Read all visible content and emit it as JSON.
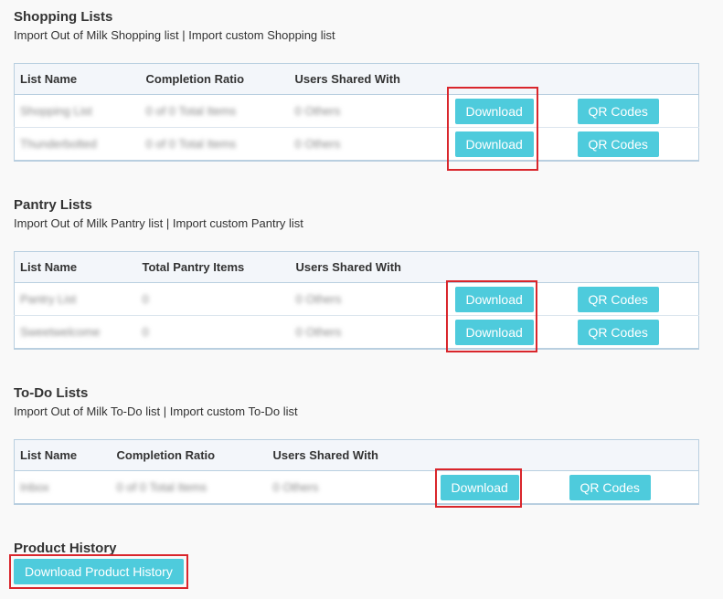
{
  "shopping": {
    "title": "Shopping Lists",
    "import_out_of_milk": "Import Out of Milk Shopping list",
    "separator": " | ",
    "import_custom": "Import custom Shopping list",
    "columns": [
      "List Name",
      "Completion Ratio",
      "Users Shared With"
    ],
    "rows": [
      {
        "name": "Shopping List",
        "ratio": "0 of 0 Total Items",
        "users": "0 Others"
      },
      {
        "name": "Thunderbolted",
        "ratio": "0 of 0 Total Items",
        "users": "0 Others"
      }
    ],
    "download_label": "Download",
    "qr_label": "QR Codes"
  },
  "pantry": {
    "title": "Pantry Lists",
    "import_out_of_milk": "Import Out of Milk Pantry list",
    "separator": " | ",
    "import_custom": "Import custom Pantry list",
    "columns": [
      "List Name",
      "Total Pantry Items",
      "Users Shared With"
    ],
    "rows": [
      {
        "name": "Pantry List",
        "items": "0",
        "users": "0 Others"
      },
      {
        "name": "Sweetwelcome",
        "items": "0",
        "users": "0 Others"
      }
    ],
    "download_label": "Download",
    "qr_label": "QR Codes"
  },
  "todo": {
    "title": "To-Do Lists",
    "import_out_of_milk": "Import Out of Milk To-Do list",
    "separator": " | ",
    "import_custom": "Import custom To-Do list",
    "columns": [
      "List Name",
      "Completion Ratio",
      "Users Shared With"
    ],
    "rows": [
      {
        "name": "Inbox",
        "ratio": "0 of 0 Total Items",
        "users": "0 Others"
      }
    ],
    "download_label": "Download",
    "qr_label": "QR Codes"
  },
  "product_history": {
    "title": "Product History",
    "button_label": "Download Product History"
  }
}
